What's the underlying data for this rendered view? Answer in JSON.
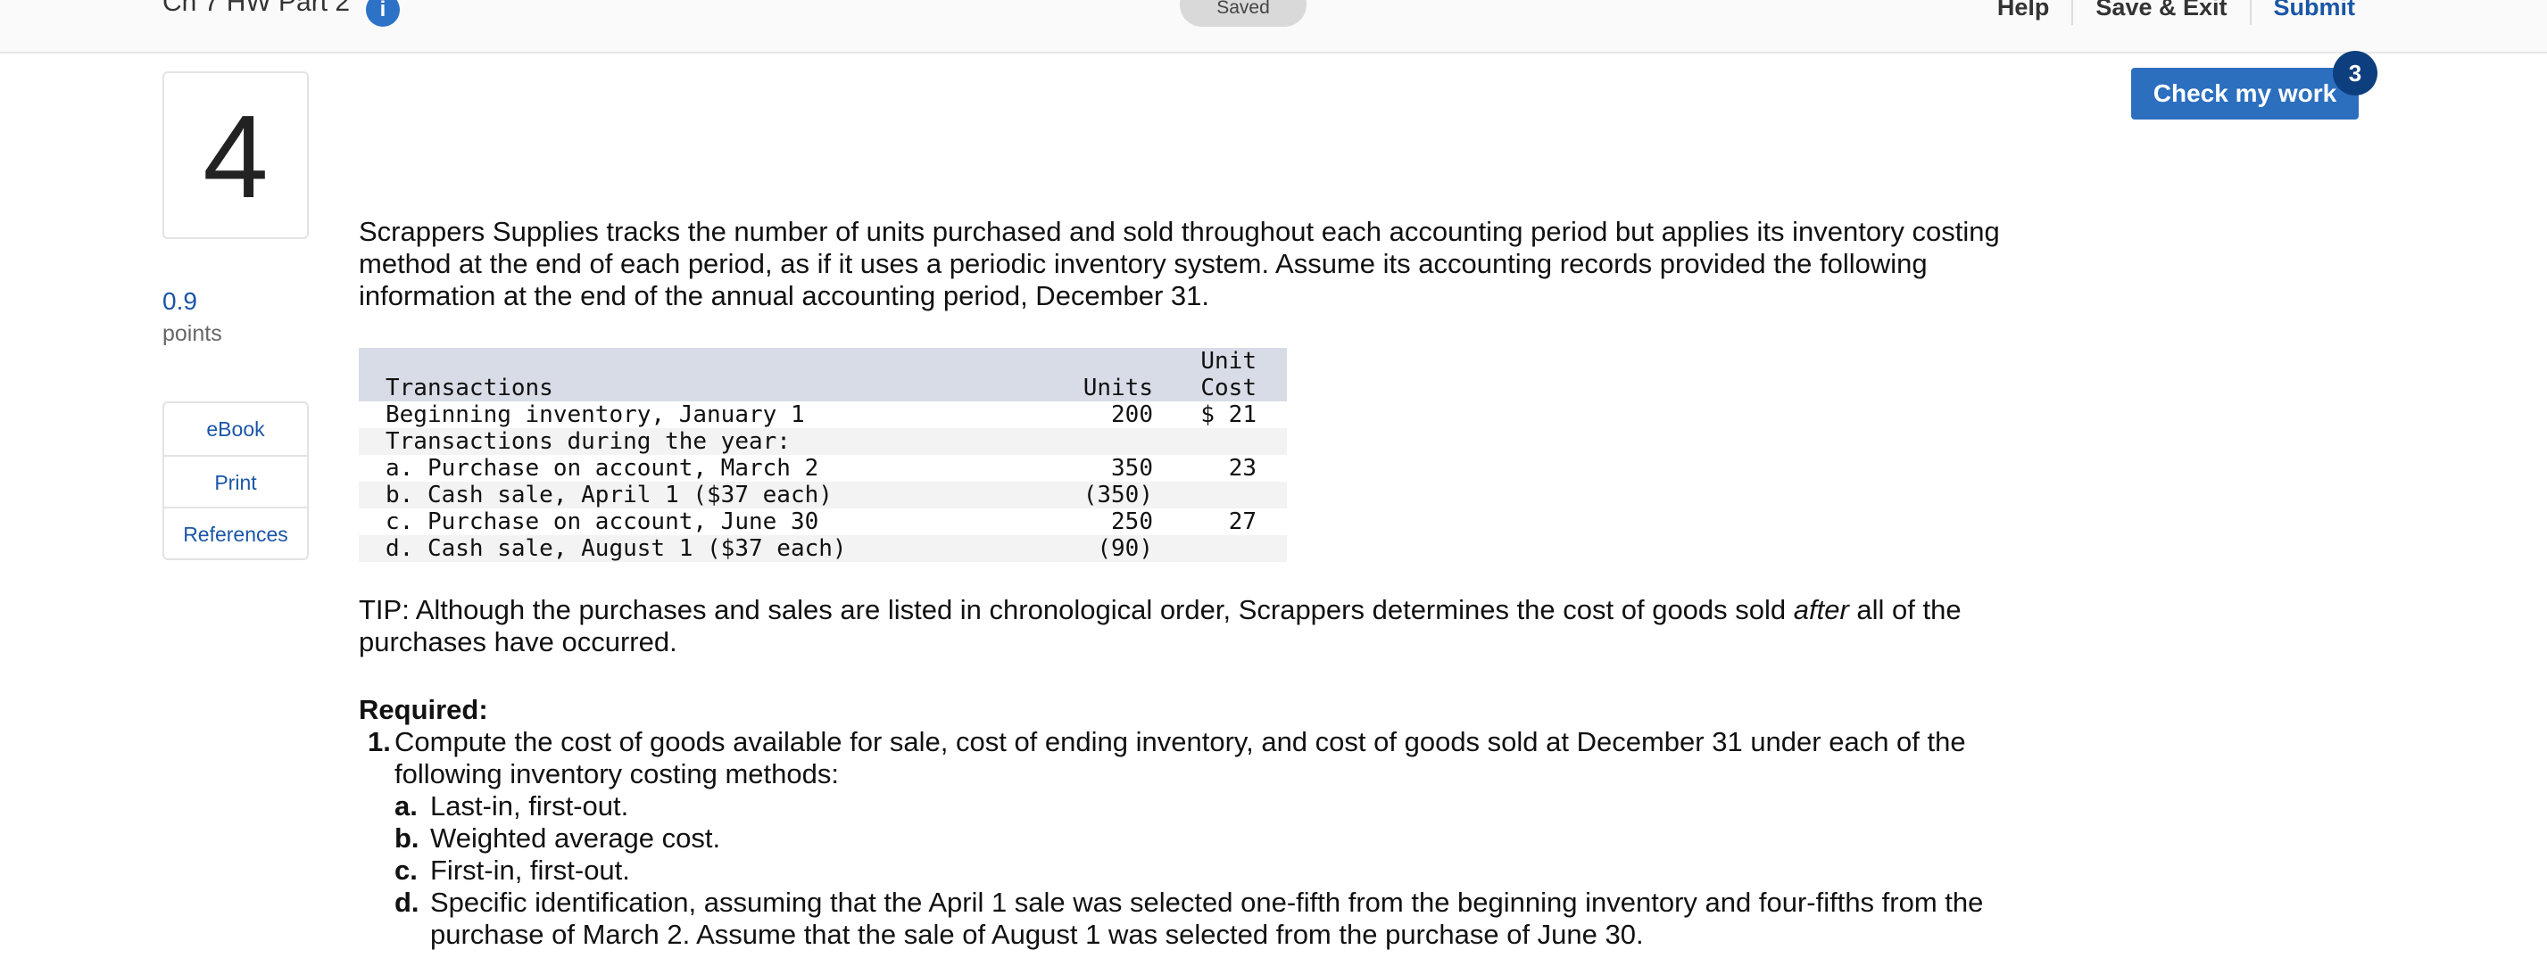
{
  "header": {
    "assignment_title": "Ch 7 HW Part 2",
    "info_icon": "i",
    "saved_status": "Saved",
    "nav": [
      "Help",
      "Save & Exit",
      "Submit"
    ]
  },
  "question": {
    "number": "4",
    "points_value": "0.9",
    "points_label": "points",
    "tools": [
      "eBook",
      "Print",
      "References"
    ]
  },
  "check_work": {
    "label": "Check my work",
    "badge": "3"
  },
  "content": {
    "intro": "Scrappers Supplies tracks the number of units purchased and sold throughout each accounting period but applies its inventory costing method at the end of each period, as if it uses a periodic inventory system. Assume its accounting records provided the following information at the end of the annual accounting period, December 31.",
    "table": {
      "headers": [
        "Transactions",
        "Units",
        "Unit\nCost"
      ],
      "rows": [
        [
          "Beginning inventory, January 1",
          "200",
          "$ 21"
        ],
        [
          "Transactions during the year:",
          "",
          ""
        ],
        [
          "a. Purchase on account, March 2",
          "350",
          "23"
        ],
        [
          "b. Cash sale, April 1 ($37 each)",
          "(350)",
          ""
        ],
        [
          "c. Purchase on account, June 30",
          "250",
          "27"
        ],
        [
          "d. Cash sale, August 1 ($37 each)",
          "(90)",
          ""
        ]
      ]
    },
    "tip_prefix": "TIP: Although the purchases and sales are listed in chronological order, Scrappers determines the cost of goods sold ",
    "tip_emphasis": "after",
    "tip_suffix": " all of the purchases have occurred.",
    "required_label": "Required:",
    "requirements": [
      {
        "num": "1.",
        "text": "Compute the cost of goods available for sale, cost of ending inventory, and cost of goods sold at December 31 under each of the following inventory costing methods:",
        "sub": [
          {
            "letter": "a.",
            "text": "Last-in, first-out."
          },
          {
            "letter": "b.",
            "text": "Weighted average cost."
          },
          {
            "letter": "c.",
            "text": "First-in, first-out."
          },
          {
            "letter": "d.",
            "text": "Specific identification, assuming that the April 1 sale was selected one-fifth from the beginning inventory and four-fifths from the purchase of March 2. Assume that the sale of August 1 was selected from the purchase of June 30."
          }
        ]
      }
    ]
  }
}
